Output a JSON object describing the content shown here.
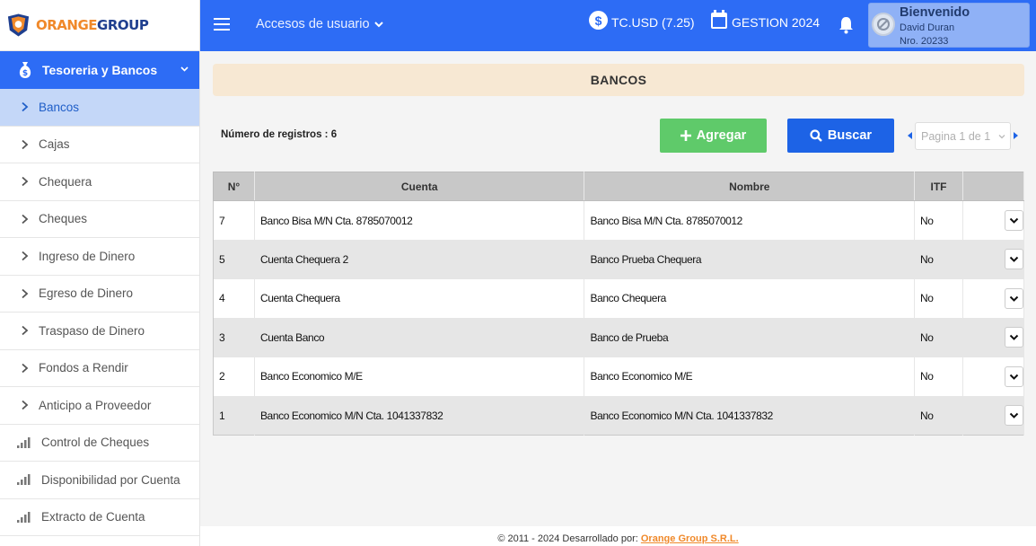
{
  "app": {
    "logo_text_1": "ORANGE",
    "logo_text_2": "GROUP"
  },
  "sidebar": {
    "section": "Tesoreria y Bancos",
    "items": [
      {
        "label": "Bancos",
        "icon": "chevron-right-icon",
        "active": true
      },
      {
        "label": "Cajas",
        "icon": "chevron-right-icon"
      },
      {
        "label": "Chequera",
        "icon": "chevron-right-icon"
      },
      {
        "label": "Cheques",
        "icon": "chevron-right-icon"
      },
      {
        "label": "Ingreso de Dinero",
        "icon": "chevron-right-icon"
      },
      {
        "label": "Egreso de Dinero",
        "icon": "chevron-right-icon"
      },
      {
        "label": "Traspaso de Dinero",
        "icon": "chevron-right-icon"
      },
      {
        "label": "Fondos a Rendir",
        "icon": "chevron-right-icon"
      },
      {
        "label": "Anticipo a Proveedor",
        "icon": "chevron-right-icon"
      },
      {
        "label": "Control de Cheques",
        "icon": "bar-chart-icon"
      },
      {
        "label": "Disponibilidad por Cuenta",
        "icon": "bar-chart-icon"
      },
      {
        "label": "Extracto de Cuenta",
        "icon": "bar-chart-icon"
      }
    ]
  },
  "topbar": {
    "accesos": "Accesos de usuario",
    "tc": "TC.USD (7.25)",
    "gestion": "GESTION 2024",
    "welcome": "Bienvenido",
    "user": "David Duran",
    "nro": "Nro. 20233"
  },
  "main": {
    "title": "BANCOS",
    "count": "Número de registros : 6",
    "add": "Agregar",
    "search": "Buscar",
    "page": "Pagina 1 de 1",
    "columns": [
      "N°",
      "Cuenta",
      "Nombre",
      "ITF",
      ""
    ],
    "rows": [
      {
        "n": "7",
        "cuenta": "Banco Bisa M/N Cta. 8785070012",
        "nombre": "Banco Bisa M/N Cta. 8785070012",
        "itf": "No"
      },
      {
        "n": "5",
        "cuenta": "Cuenta Chequera 2",
        "nombre": "Banco Prueba Chequera",
        "itf": "No"
      },
      {
        "n": "4",
        "cuenta": "Cuenta Chequera",
        "nombre": "Banco Chequera",
        "itf": "No"
      },
      {
        "n": "3",
        "cuenta": "Cuenta Banco",
        "nombre": "Banco de Prueba",
        "itf": "No"
      },
      {
        "n": "2",
        "cuenta": "Banco Economico M/E",
        "nombre": "Banco Economico M/E",
        "itf": "No"
      },
      {
        "n": "1",
        "cuenta": "Banco Economico M/N Cta. 1041337832",
        "nombre": "Banco Economico M/N Cta. 1041337832",
        "itf": "No"
      }
    ]
  },
  "footer": {
    "text": "© 2011 - 2024 Desarrollado por: ",
    "link": "Orange Group S.R.L."
  },
  "colors": {
    "primary": "#2d6cf5",
    "accent": "#f0892a",
    "add": "#5fca6a"
  }
}
